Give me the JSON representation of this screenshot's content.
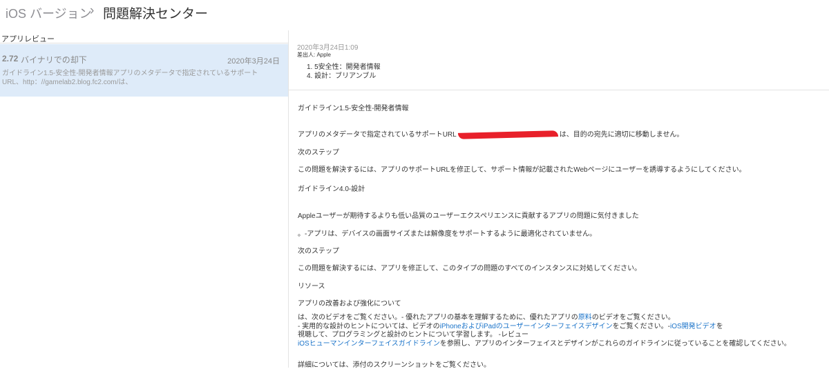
{
  "header": {
    "parent": "iOS バージョン",
    "chevron": "›",
    "title": "問題解決センター"
  },
  "sidebar": {
    "heading": "アプリレビュー",
    "item": {
      "version": "2.72",
      "title": "バイナリでの却下",
      "date": "2020年3月24日",
      "description": "ガイドライン1.5-安全性-開発者情報アプリのメタデータで指定されているサポートURL、http：//gamelab2.blog.fc2.com/は、"
    }
  },
  "message": {
    "date": "2020年3月24日1:09",
    "sender": "差出人: Apple",
    "list": [
      "1. 5安全性：開発者情報",
      "4. 設計：ブリアンブル"
    ],
    "g1_title": "ガイドライン1.5-安全性-開発者情報",
    "g1_body_a": "アプリのメタデータで指定されているサポートURL",
    "g1_body_b": "は、目的の宛先に適切に移動しません。",
    "next1": "次のステップ",
    "next1_body": "この問題を解決するには、アプリのサポートURLを修正して、サポート情報が記載されたWebページにユーザーを誘導するようにしてください。",
    "g2_title": "ガイドライン4.0-設計",
    "g2_body": "Appleユーザーが期待するよりも低い品質のユーザーエクスペリエンスに貢献するアプリの問題に気付きました",
    "g2_bullet": "。-アプリは、デバイスの画面サイズまたは解像度をサポートするように最適化されていません。",
    "next2": "次のステップ",
    "next2_body": "この問題を解決するには、アプリを修正して、このタイプの問題のすべてのインスタンスに対処してください。",
    "resources": "リソース",
    "improve": "アプリの改善および強化について",
    "r1_a": "は、次のビデオをご覧ください。- 優れたアプリの基本を理解するために、優れたアプリの",
    "r1_link": "原料",
    "r1_b": "のビデオをご覧ください。",
    "r2_a": "- 実用的な設計のヒントについては、ビデオの",
    "r2_link": "iPhoneおよびiPadのユーザーインターフェイスデザイン",
    "r2_b": "をご覧ください。-",
    "r2_link2": "iOS開発ビデオ",
    "r2_c": "を",
    "r3": "視聴して、プログラミングと設計のヒントについて学習します。 -レビュー",
    "r4_link": "iOSヒューマンインターフェイスガイドライン",
    "r4_b": "を参照し、アプリのインターフェイスとデザインがこれらのガイドラインに従っていることを確認してください。",
    "details": "詳細については、添付のスクリーンショットをご覧ください。"
  },
  "colors": {
    "accent": "#1a73c9",
    "selected": "#deebf9",
    "redaction": "#e8202a"
  }
}
